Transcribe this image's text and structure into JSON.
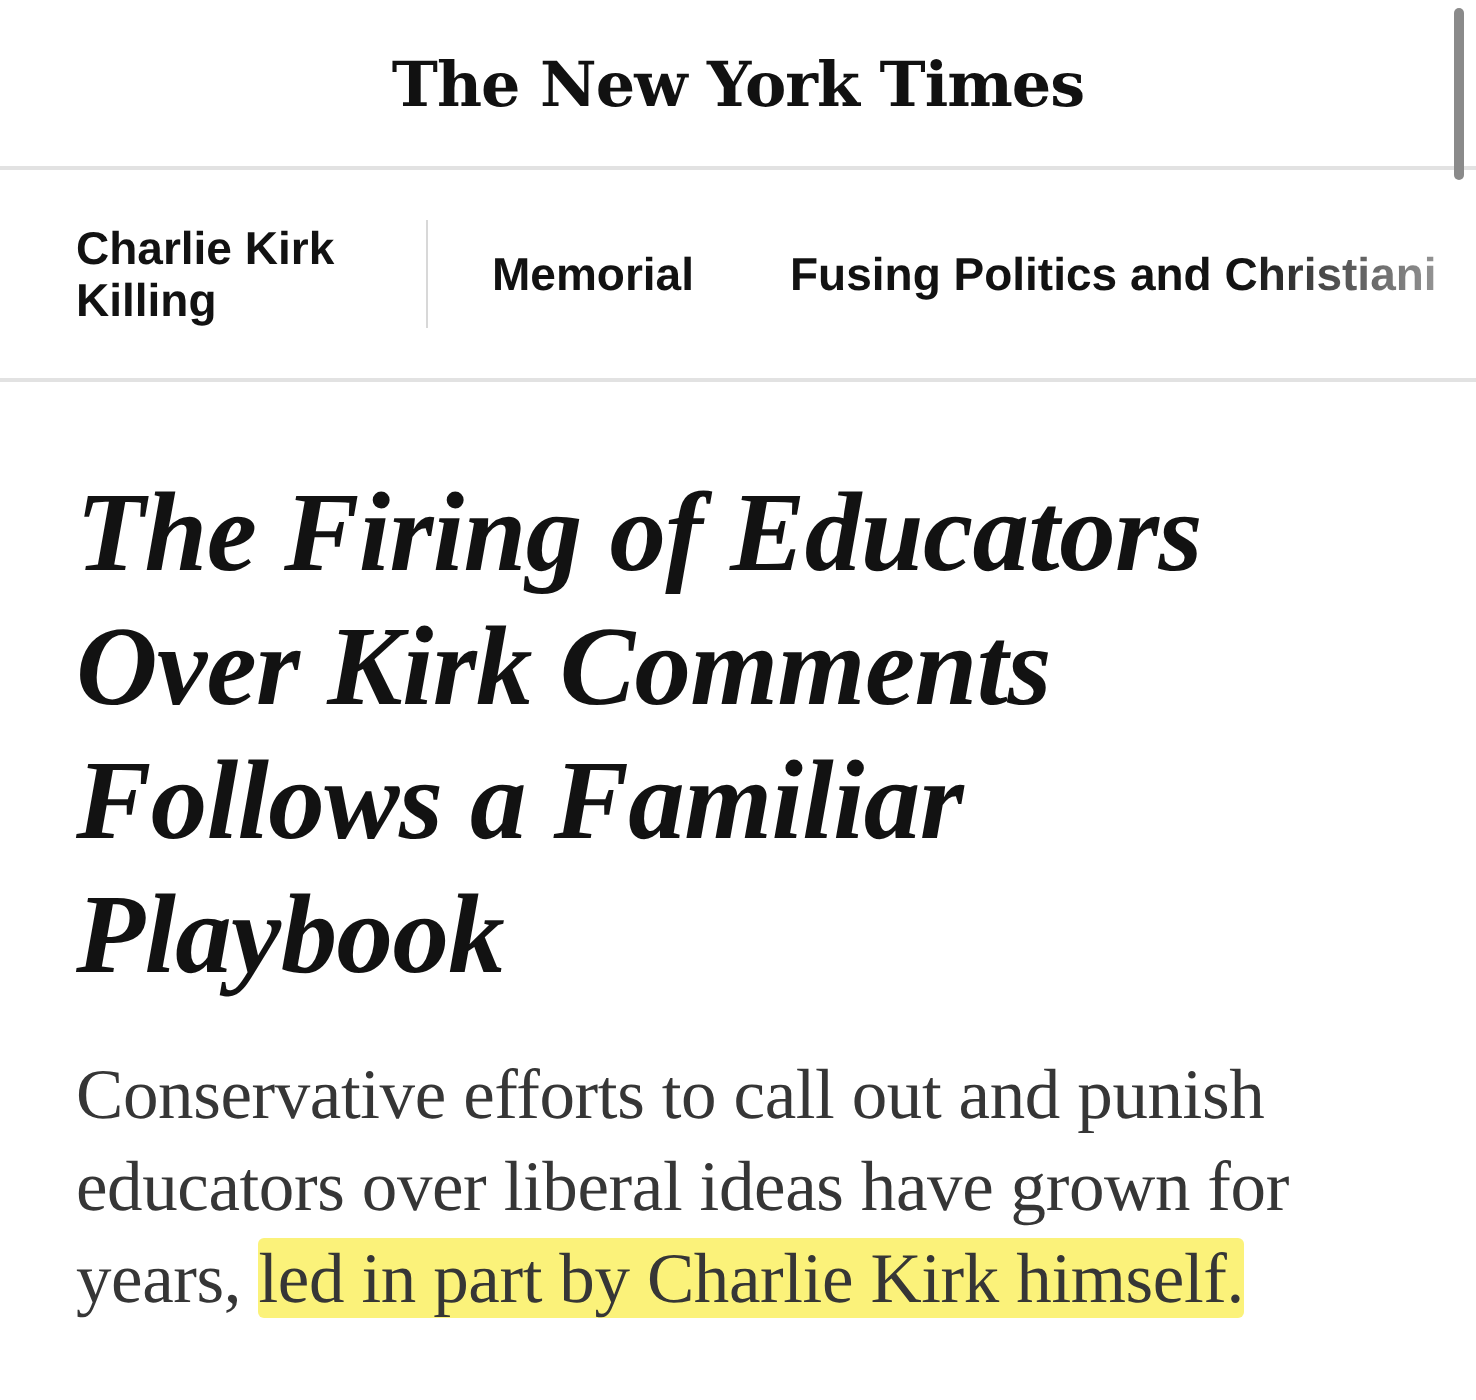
{
  "masthead": {
    "title": "The New York Times"
  },
  "section_nav": {
    "label": "Charlie Kirk Killing",
    "items": [
      {
        "label": "Memorial"
      },
      {
        "label": "Fusing Politics and Christiani"
      }
    ]
  },
  "article": {
    "headline": "The Firing of Educators Over Kirk Comments Follows a Familiar Playbook",
    "summary": [
      {
        "text": "Conservative efforts to call out and punish educators over liberal ideas have grown for years, ",
        "highlighted": false
      },
      {
        "text": "led in part by Charlie Kirk himself.",
        "highlighted": true
      }
    ]
  }
}
